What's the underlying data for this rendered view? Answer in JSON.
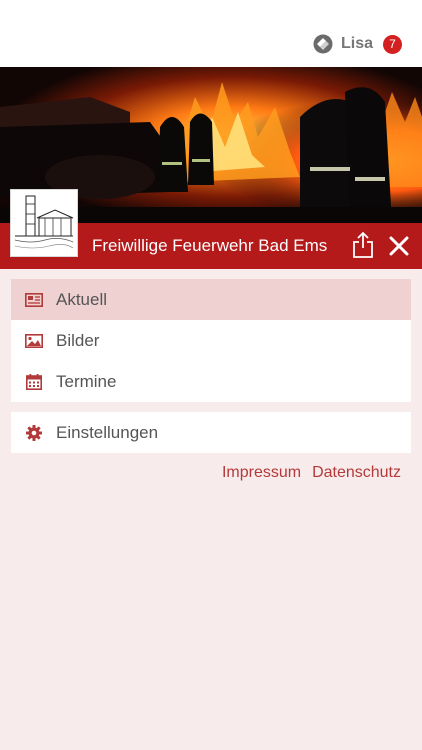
{
  "user": {
    "name": "Lisa",
    "notifications": "7"
  },
  "header": {
    "title": "Freiwillige Feuerwehr Bad Ems"
  },
  "menu": {
    "main": [
      {
        "label": "Aktuell",
        "icon": "newspaper-icon",
        "active": true
      },
      {
        "label": "Bilder",
        "icon": "image-icon",
        "active": false
      },
      {
        "label": "Termine",
        "icon": "calendar-icon",
        "active": false
      }
    ],
    "secondary": [
      {
        "label": "Einstellungen",
        "icon": "gear-icon"
      }
    ]
  },
  "footer": {
    "impressum": "Impressum",
    "datenschutz": "Datenschutz"
  },
  "colors": {
    "accent": "#b41a1a",
    "background": "#f8ebeb",
    "active_item": "#efd1d1",
    "badge": "#d32121",
    "link": "#b33a3a"
  }
}
